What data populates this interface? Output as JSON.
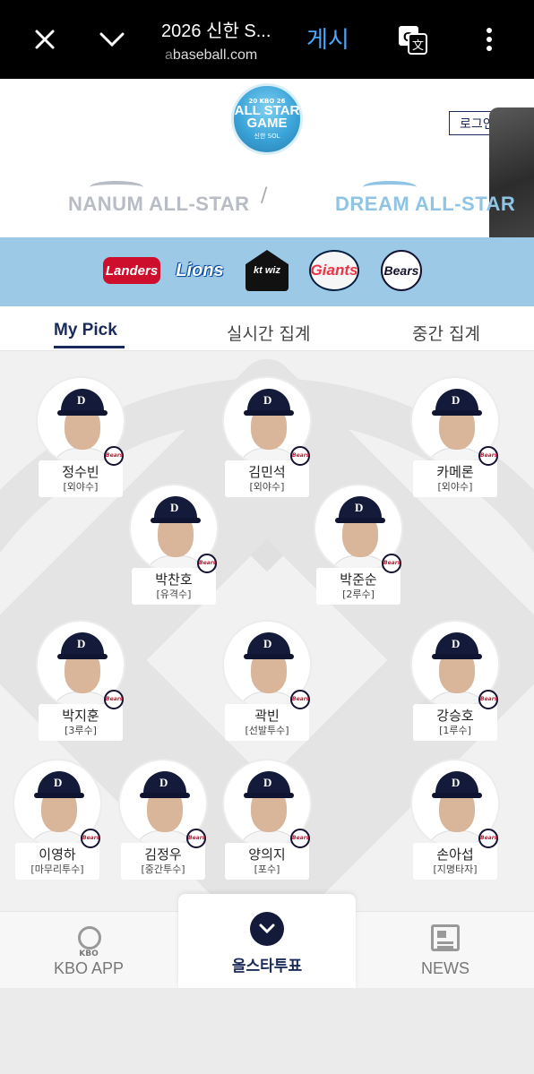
{
  "browser": {
    "title": "2026 신한 S...",
    "url_prefix": "a",
    "url_domain": "baseball.com",
    "action_label": "게시",
    "icons": [
      "close-icon",
      "chevron-down-icon",
      "translate-icon",
      "more-vert-icon"
    ]
  },
  "header": {
    "badge_top": "20 KBO 26",
    "badge_title_line1": "ALL STAR",
    "badge_title_line2": "GAME",
    "badge_sponsor": "신한 SOL",
    "login_label": "로그인",
    "nanum_label": "NANUM ALL-STAR",
    "divider": "/",
    "dream_label": "DREAM ALL-STAR"
  },
  "teams": [
    {
      "key": "ssg",
      "label": "Landers"
    },
    {
      "key": "lions",
      "label": "Lions"
    },
    {
      "key": "kt",
      "label": "kt wiz"
    },
    {
      "key": "giants",
      "label": "Giants"
    },
    {
      "key": "bears",
      "label": "Bears"
    }
  ],
  "tabs": {
    "my_pick": "My Pick",
    "live": "실시간 집계",
    "interim": "중간 집계"
  },
  "players": [
    {
      "name": "정수빈",
      "position": "[외야수]"
    },
    {
      "name": "김민석",
      "position": "[외야수]"
    },
    {
      "name": "카메론",
      "position": "[외야수]"
    },
    {
      "name": "박찬호",
      "position": "[유격수]"
    },
    {
      "name": "박준순",
      "position": "[2루수]"
    },
    {
      "name": "박지훈",
      "position": "[3루수]"
    },
    {
      "name": "곽빈",
      "position": "[선발투수]"
    },
    {
      "name": "강승호",
      "position": "[1루수]"
    },
    {
      "name": "이영하",
      "position": "[마무리투수]"
    },
    {
      "name": "김정우",
      "position": "[중간투수]"
    },
    {
      "name": "양의지",
      "position": "[포수]"
    },
    {
      "name": "손아섭",
      "position": "[지명타자]"
    }
  ],
  "team_badge": "Bears",
  "bottom_nav": {
    "kbo_mini": "KBO",
    "kbo_app": "KBO APP",
    "vote": "올스타투표",
    "news": "NEWS"
  },
  "colors": {
    "navy": "#1a2a5a",
    "team_strip": "#9cc9e6",
    "browser_action": "#4aa8ff"
  }
}
